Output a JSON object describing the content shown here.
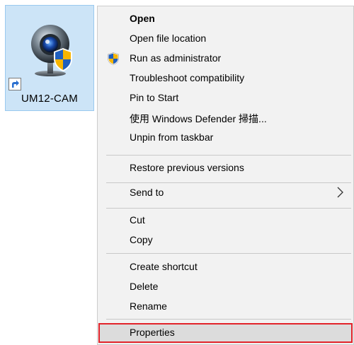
{
  "desktop": {
    "shortcut": {
      "label": "UM12-CAM",
      "icon": "webcam-shield-icon",
      "overlay_icon": "shortcut-arrow-icon"
    }
  },
  "context_menu": {
    "items": [
      {
        "label": "Open",
        "bold": true
      },
      {
        "label": "Open file location"
      },
      {
        "label": "Run as administrator",
        "icon": "uac-shield-icon"
      },
      {
        "label": "Troubleshoot compatibility"
      },
      {
        "label": "Pin to Start"
      },
      {
        "label": "使用 Windows Defender 掃描..."
      },
      {
        "label": "Unpin from taskbar"
      },
      {
        "label": "Restore previous versions"
      },
      {
        "label": "Send to",
        "submenu": true,
        "icon": "chevron-right-icon"
      },
      {
        "label": "Cut"
      },
      {
        "label": "Copy"
      },
      {
        "label": "Create shortcut"
      },
      {
        "label": "Delete"
      },
      {
        "label": "Rename"
      },
      {
        "label": "Properties",
        "highlighted": true
      }
    ]
  },
  "colors": {
    "selection_fill": "#cce4f7",
    "menu_background": "#f2f2f2",
    "highlight_border": "#e2232a",
    "shield_blue": "#1f5fbf",
    "shield_yellow": "#f7b500"
  }
}
